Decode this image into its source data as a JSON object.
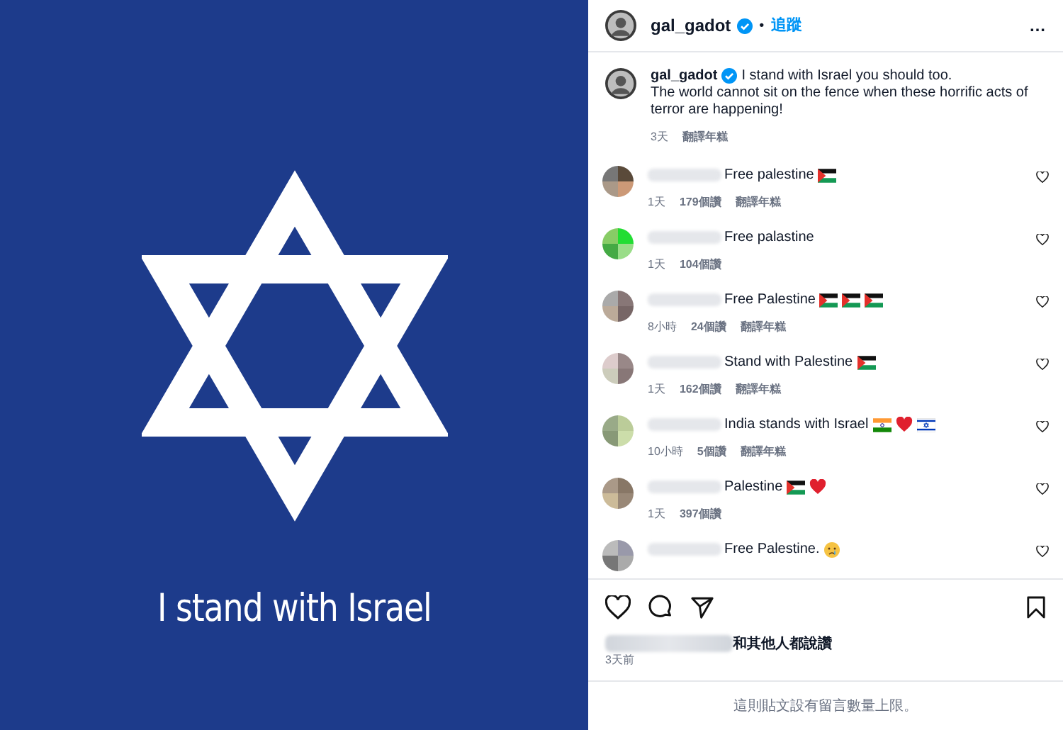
{
  "post_image": {
    "caption_text": "I stand with Israel"
  },
  "header": {
    "username": "gal_gadot",
    "verified": true,
    "separator": "•",
    "follow": "追蹤",
    "more": "…"
  },
  "caption": {
    "username": "gal_gadot",
    "verified": true,
    "text": "I stand with Israel you should too.\nThe world cannot sit on the fence when these horrific acts of terror are happening!",
    "time": "3天",
    "translate": "翻譯年糕"
  },
  "comments": [
    {
      "text": "Free palestine",
      "marks": [
        {
          "kind": "flag_ps"
        }
      ],
      "time": "1天",
      "likes": "179個讚",
      "translate": "翻譯年糕"
    },
    {
      "text": "Free palastine",
      "time": "1天",
      "likes": "104個讚"
    },
    {
      "text": "Free Palestine",
      "marks": [
        {
          "kind": "flag_ps"
        },
        {
          "kind": "flag_ps"
        },
        {
          "kind": "flag_ps"
        }
      ],
      "time": "8小時",
      "likes": "24個讚",
      "translate": "翻譯年糕"
    },
    {
      "text": "Stand with Palestine",
      "marks": [
        {
          "kind": "flag_ps"
        }
      ],
      "time": "1天",
      "likes": "162個讚",
      "translate": "翻譯年糕"
    },
    {
      "text": "India stands with Israel",
      "marks": [
        {
          "kind": "flag_in"
        },
        {
          "kind": "heart"
        },
        {
          "kind": "flag_il"
        }
      ],
      "time": "10小時",
      "likes": "5個讚",
      "translate": "翻譯年糕"
    },
    {
      "text": "Palestine",
      "marks": [
        {
          "kind": "flag_ps"
        },
        {
          "kind": "heart"
        }
      ],
      "time": "1天",
      "likes": "397個讚"
    },
    {
      "text": "Free Palestine.",
      "marks": [
        {
          "kind": "crying"
        }
      ]
    }
  ],
  "likes_text": "和其他人都說讚",
  "post_time": "3天前",
  "footer": "這則貼文設有留言數量上限。"
}
